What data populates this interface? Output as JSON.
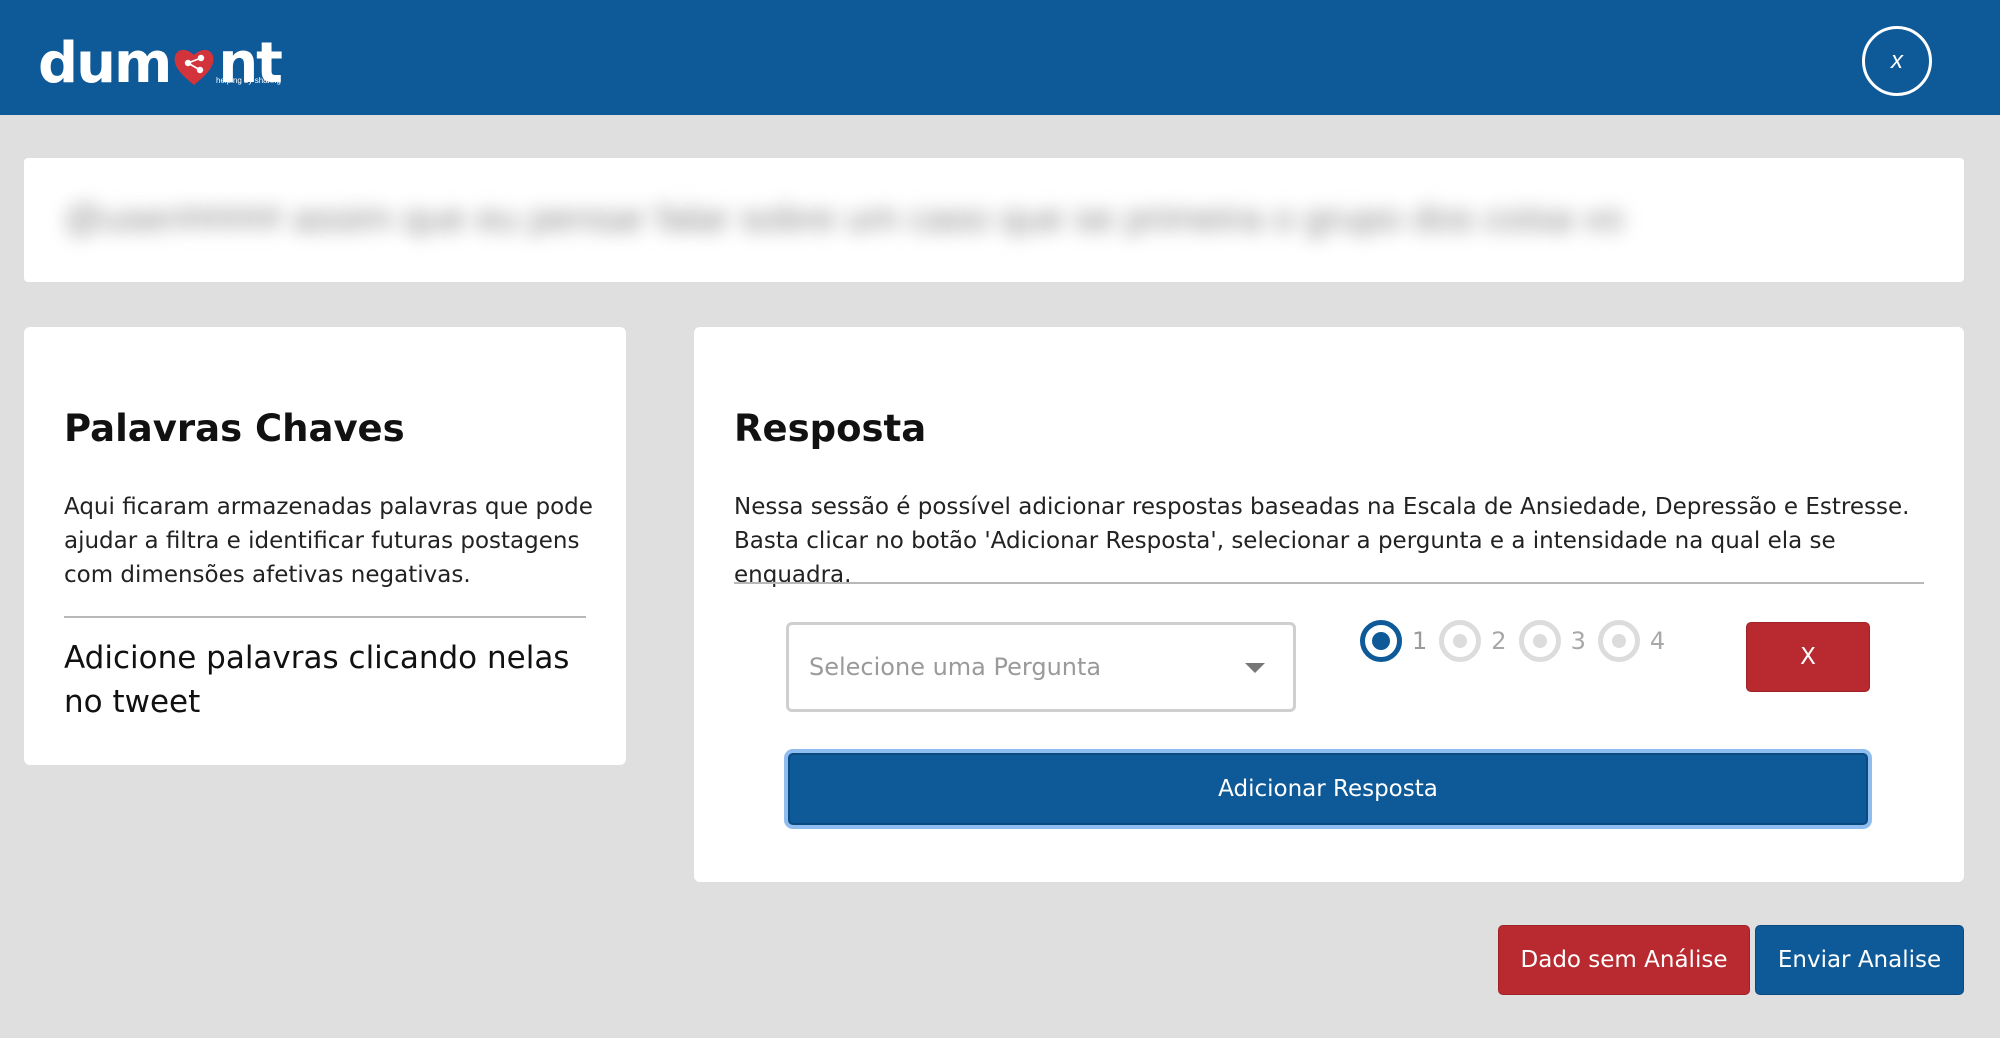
{
  "header": {
    "logo_text_left": "dum",
    "logo_text_right": "nt",
    "logo_tagline": "helping by sharing",
    "close_label": "x",
    "brand_color": "#0e5a98"
  },
  "tweet": {
    "text": "@user#####  assim que eu pensar falar sobre um caso que se primeira o grupo dos coisa vo"
  },
  "keywords": {
    "title": "Palavras Chaves",
    "description": "Aqui ficaram armazenadas palavras que pode ajudar a filtra e identificar futuras postagens com dimensões afetivas negativas.",
    "hint": "Adicione palavras clicando nelas no tweet"
  },
  "response": {
    "title": "Resposta",
    "description_line1": "Nessa sessão é possível adicionar respostas baseadas na Escala de Ansiedade, Depressão e Estresse.",
    "description_line2": "Basta clicar no botão 'Adicionar Resposta', selecionar a pergunta e a intensidade na qual ela se enquadra.",
    "select_placeholder": "Selecione uma Pergunta",
    "intensity_options": [
      "1",
      "2",
      "3",
      "4"
    ],
    "selected_intensity": "1",
    "remove_label": "X",
    "add_label": "Adicionar Resposta"
  },
  "footer": {
    "no_data_label": "Dado sem Análise",
    "send_label": "Enviar Analise"
  },
  "colors": {
    "primary": "#0e5a98",
    "danger": "#b82a2f",
    "background": "#dfdfdf"
  }
}
